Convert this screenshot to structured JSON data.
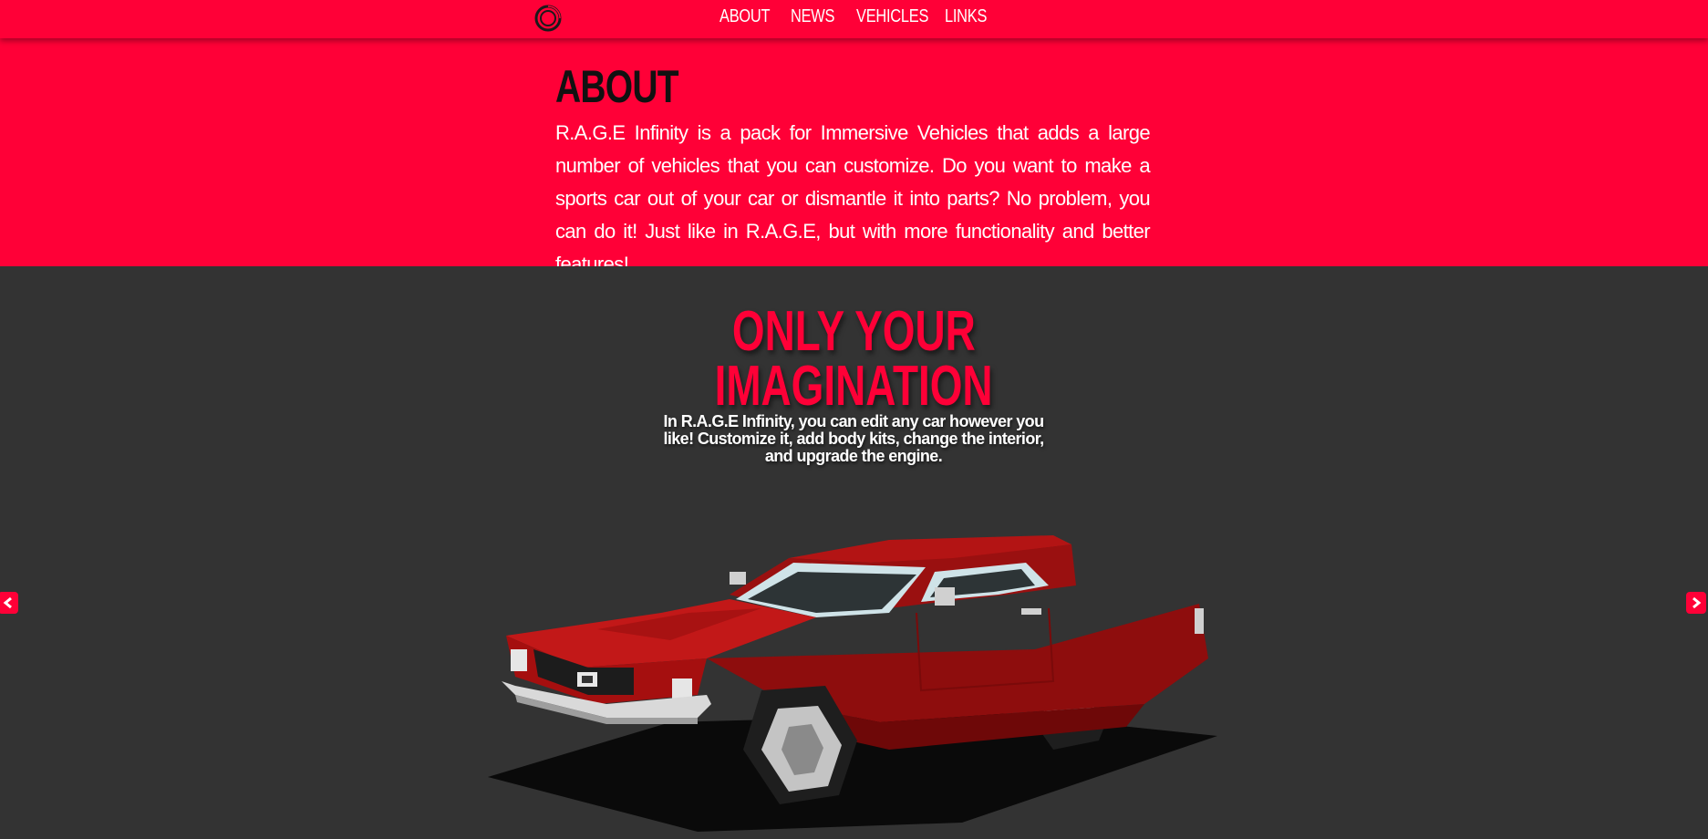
{
  "nav": {
    "logo_icon": "rage-logo-icon",
    "links": [
      "ABOUT",
      "NEWS",
      "VEHICLES",
      "LINKS"
    ]
  },
  "about": {
    "title": "ABOUT",
    "text": "R.A.G.E Infinity is a pack for Immersive Vehicles that adds a large number of vehicles that you can customize. Do you want to make a sports car out of your car or dismantle it into parts? No problem, you can do it! Just like in R.A.G.E, but with more functionality and better features!"
  },
  "showcase": {
    "headline_line1": "ONLY YOUR",
    "headline_line2": "IMAGINATION",
    "subtext": "In R.A.G.E Infinity, you can edit any car however you like! Customize it, add body kits, change the interior, and upgrade the engine.",
    "image": "red-blocky-muscle-car",
    "prev_icon": "chevron-left-icon",
    "next_icon": "chevron-right-icon"
  },
  "colors": {
    "accent": "#ff0037",
    "dark_bg": "#333333",
    "text_light": "#ffffff",
    "text_dark": "#111111"
  }
}
